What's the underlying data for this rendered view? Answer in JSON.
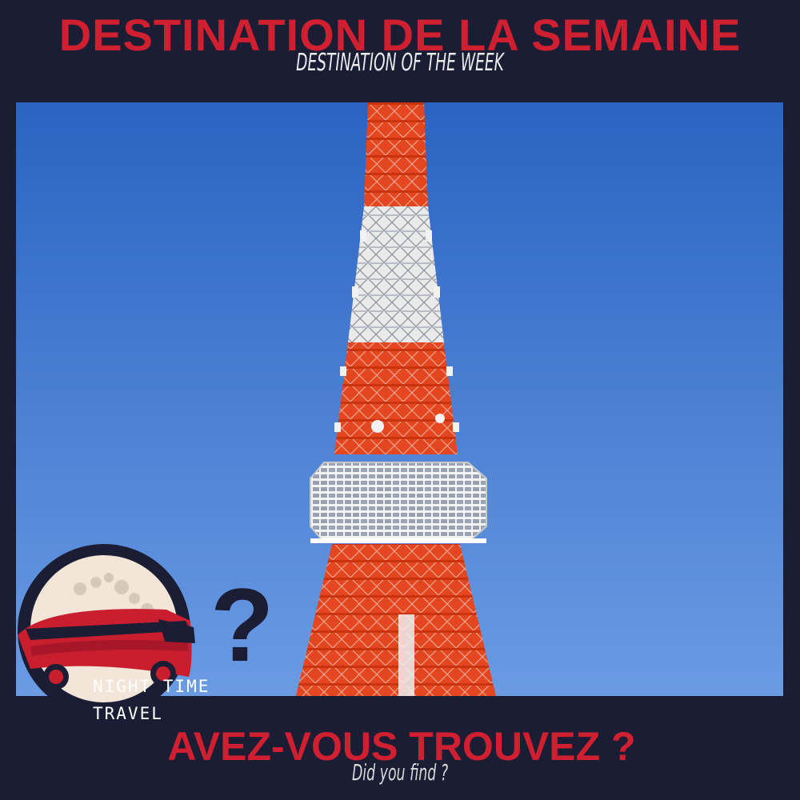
{
  "header": {
    "title": "DESTINATION DE LA SEMAINE",
    "subtitle": "DESTINATION OF THE WEEK"
  },
  "photo": {
    "subject_icon": "radio-tower-icon",
    "sky_color": "#3f79d4",
    "tower_color": "#e8421e"
  },
  "logo": {
    "line1": "NIGHT TIME",
    "line2": "TRAVEL",
    "icon": "bus-moon-logo-icon",
    "question_mark": "?",
    "accent_color": "#c81e2e"
  },
  "footer": {
    "question": "AVEZ-VOUS TROUVEZ ?",
    "translation": "Did you find ?"
  },
  "colors": {
    "background": "#1a1d33",
    "accent": "#d01f30"
  }
}
